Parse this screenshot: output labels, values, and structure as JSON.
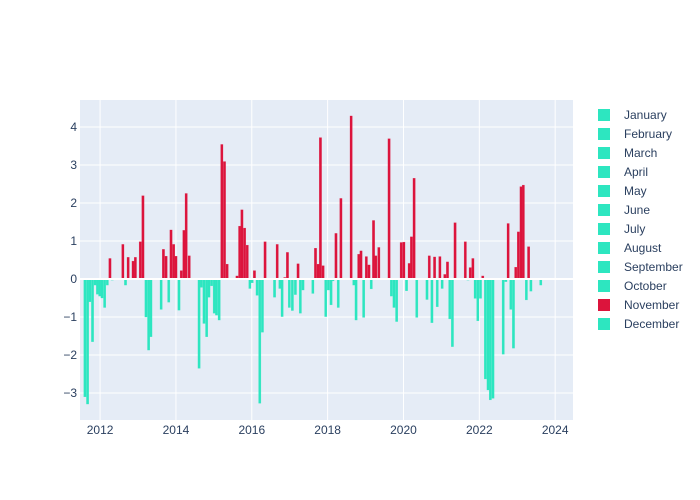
{
  "chart_data": {
    "type": "bar",
    "title": "",
    "xlabel": "",
    "ylabel": "",
    "xlim": [
      2011.47,
      2024.47
    ],
    "ylim": [
      -3.71,
      4.71
    ],
    "grid": true,
    "legend_position": "right",
    "x_ticks": [
      {
        "value": 2012,
        "label": "2012"
      },
      {
        "value": 2014,
        "label": "2014"
      },
      {
        "value": 2016,
        "label": "2016"
      },
      {
        "value": 2018,
        "label": "2018"
      },
      {
        "value": 2020,
        "label": "2020"
      },
      {
        "value": 2022,
        "label": "2022"
      },
      {
        "value": 2024,
        "label": "2024"
      }
    ],
    "y_ticks": [
      {
        "value": -3,
        "label": "−3"
      },
      {
        "value": -2,
        "label": "−2"
      },
      {
        "value": -1,
        "label": "−1"
      },
      {
        "value": 0,
        "label": "0"
      },
      {
        "value": 1,
        "label": "1"
      },
      {
        "value": 2,
        "label": "2"
      },
      {
        "value": 3,
        "label": "3"
      },
      {
        "value": 4,
        "label": "4"
      }
    ],
    "colors": {
      "positive": "#dc143c",
      "negative": "#2de6c0"
    },
    "legend": [
      {
        "name": "January",
        "color": "#2de6c0"
      },
      {
        "name": "February",
        "color": "#2de6c0"
      },
      {
        "name": "March",
        "color": "#2de6c0"
      },
      {
        "name": "April",
        "color": "#2de6c0"
      },
      {
        "name": "May",
        "color": "#2de6c0"
      },
      {
        "name": "June",
        "color": "#2de6c0"
      },
      {
        "name": "July",
        "color": "#2de6c0"
      },
      {
        "name": "August",
        "color": "#2de6c0"
      },
      {
        "name": "September",
        "color": "#2de6c0"
      },
      {
        "name": "October",
        "color": "#2de6c0"
      },
      {
        "name": "November",
        "color": "#dc143c"
      },
      {
        "name": "December",
        "color": "#2de6c0"
      }
    ],
    "x": [
      2011.6,
      2011.67,
      2011.73,
      2011.8,
      2011.87,
      2011.93,
      2011.99,
      2012.05,
      2012.12,
      2012.19,
      2012.26,
      2012.32,
      2012.6,
      2012.67,
      2012.74,
      2012.87,
      2012.93,
      2013.06,
      2013.13,
      2013.21,
      2013.28,
      2013.34,
      2013.61,
      2013.67,
      2013.74,
      2013.81,
      2013.87,
      2013.94,
      2014.0,
      2014.08,
      2014.14,
      2014.21,
      2014.27,
      2014.35,
      2014.61,
      2014.67,
      2014.74,
      2014.81,
      2014.87,
      2014.94,
      2015.01,
      2015.07,
      2015.14,
      2015.21,
      2015.28,
      2015.35,
      2015.61,
      2015.68,
      2015.74,
      2015.81,
      2015.88,
      2015.95,
      2016.01,
      2016.07,
      2016.14,
      2016.21,
      2016.28,
      2016.35,
      2016.6,
      2016.67,
      2016.74,
      2016.8,
      2016.87,
      2016.94,
      2016.99,
      2017.07,
      2017.15,
      2017.22,
      2017.28,
      2017.35,
      2017.61,
      2017.68,
      2017.75,
      2017.81,
      2017.88,
      2017.95,
      2018.02,
      2018.09,
      2018.14,
      2018.22,
      2018.28,
      2018.35,
      2018.62,
      2018.69,
      2018.75,
      2018.82,
      2018.88,
      2018.95,
      2019.02,
      2019.09,
      2019.15,
      2019.21,
      2019.27,
      2019.35,
      2019.62,
      2019.68,
      2019.75,
      2019.82,
      2019.94,
      2020.01,
      2020.08,
      2020.15,
      2020.21,
      2020.28,
      2020.35,
      2020.62,
      2020.68,
      2020.75,
      2020.82,
      2020.89,
      2020.96,
      2021.02,
      2021.09,
      2021.16,
      2021.22,
      2021.29,
      2021.36,
      2021.63,
      2021.7,
      2021.76,
      2021.83,
      2021.89,
      2021.96,
      2022.03,
      2022.09,
      2022.16,
      2022.23,
      2022.29,
      2022.36,
      2022.63,
      2022.7,
      2022.76,
      2022.83,
      2022.9,
      2022.96,
      2023.03,
      2023.1,
      2023.16,
      2023.24,
      2023.3,
      2023.36,
      2023.62
    ],
    "values": [
      -3.1,
      -3.29,
      -0.6,
      -1.65,
      -0.16,
      -0.4,
      -0.45,
      -0.5,
      -0.75,
      -0.16,
      0.54,
      -0.03,
      0.91,
      -0.16,
      0.57,
      0.47,
      0.57,
      0.98,
      2.19,
      -1.0,
      -1.87,
      -1.52,
      -0.8,
      0.78,
      0.6,
      -0.61,
      1.29,
      0.91,
      0.6,
      -0.82,
      0.22,
      1.28,
      2.25,
      0.61,
      -2.35,
      -0.22,
      -1.17,
      -1.52,
      -0.48,
      -0.18,
      -0.9,
      -0.95,
      -1.08,
      3.54,
      3.09,
      0.39,
      0.08,
      1.39,
      1.82,
      1.34,
      0.89,
      -0.25,
      -0.1,
      0.22,
      -0.43,
      -3.27,
      -1.4,
      0.98,
      -0.48,
      0.91,
      -0.25,
      -0.99,
      0.04,
      0.7,
      -0.75,
      -0.83,
      -0.41,
      0.4,
      -0.9,
      -0.29,
      -0.38,
      0.81,
      0.39,
      3.72,
      0.35,
      -0.99,
      -0.29,
      -0.68,
      -0.05,
      1.2,
      -0.75,
      2.12,
      4.29,
      -0.16,
      -1.08,
      0.65,
      0.74,
      -1.01,
      0.59,
      0.37,
      -0.26,
      1.54,
      0.61,
      0.83,
      3.69,
      -0.45,
      -0.75,
      -1.12,
      0.96,
      0.97,
      -0.31,
      0.41,
      1.11,
      2.65,
      -1.01,
      -0.54,
      0.61,
      -1.15,
      0.58,
      -0.73,
      0.59,
      -0.25,
      0.12,
      0.45,
      -1.05,
      -1.78,
      1.48,
      0.98,
      -0.03,
      0.3,
      0.54,
      -0.51,
      -1.1,
      -0.51,
      0.08,
      -2.63,
      -2.92,
      -3.18,
      -3.14,
      -1.98,
      -0.07,
      1.46,
      -0.8,
      -1.82,
      0.31,
      1.24,
      2.43,
      2.47,
      -0.55,
      0.85,
      -0.32,
      -0.16
    ]
  }
}
